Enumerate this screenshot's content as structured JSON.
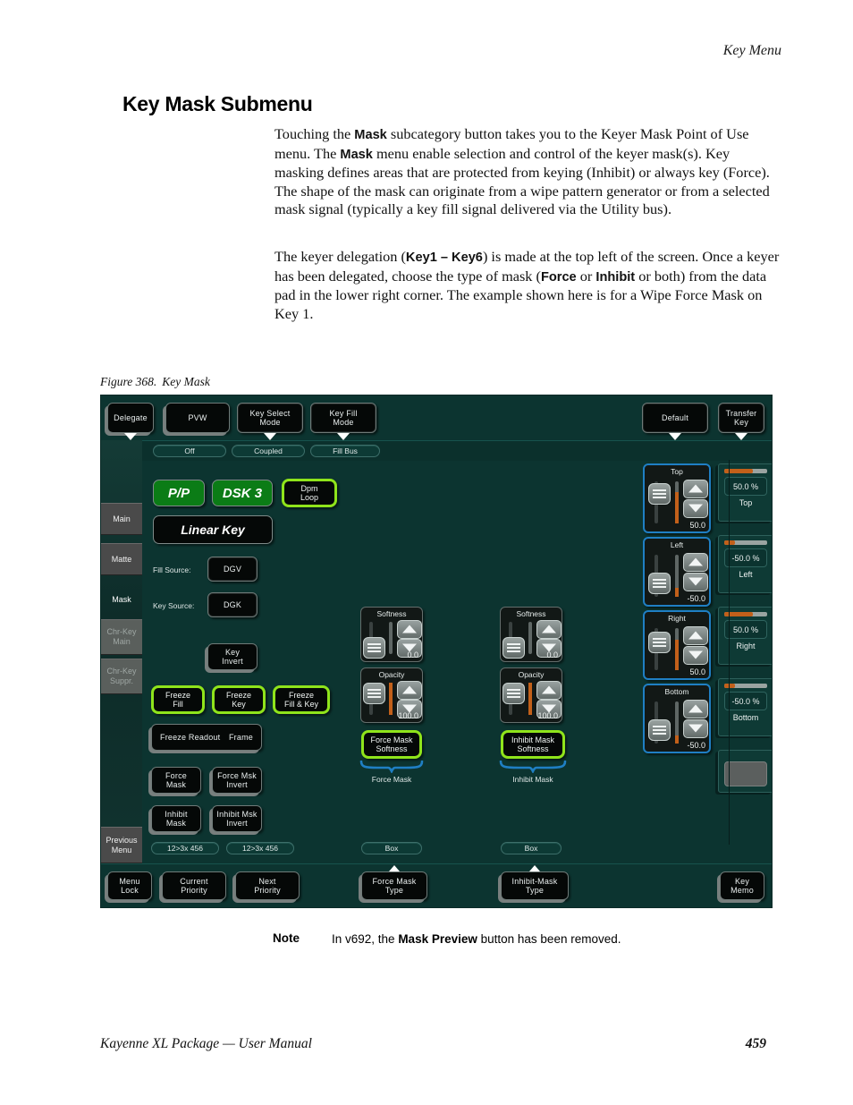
{
  "page": {
    "running_head": "Key Menu",
    "title": "Key Mask Submenu",
    "footer_left": "Kayenne XL Package  —  User Manual",
    "footer_page": "459"
  },
  "paragraphs": {
    "p1_a": "Touching the ",
    "p1_b1": "Mask",
    "p1_c": " subcategory button takes you to the Keyer Mask Point of Use menu. The ",
    "p1_b2": "Mask",
    "p1_d": " menu enable selection and control of the keyer mask(s). Key masking defines areas that are protected from keying (Inhibit) or always key (Force). The shape of the mask can originate from a wipe pattern generator or from a selected mask signal (typically a key fill signal delivered via the Utility bus).",
    "p2_a": "The keyer delegation (",
    "p2_b1": "Key1 – Key6",
    "p2_c": ") is made at the top left of the screen. Once a keyer has been delegated, choose the type of mask (",
    "p2_b2": "Force",
    "p2_d": " or ",
    "p2_b3": "Inhibit",
    "p2_e": "  or both) from the data pad in the lower right corner. The example shown here is for a Wipe Force Mask on Key 1."
  },
  "figure": {
    "number": "Figure 368.",
    "caption": "Key Mask"
  },
  "note": {
    "label": "Note",
    "text_a": "In v692, the ",
    "text_b": "Mask Preview",
    "text_c": " button has been removed."
  },
  "ui": {
    "topbar": {
      "delegate": "Delegate",
      "pvw": "PVW",
      "key_select_mode": "Key Select\nMode",
      "key_fill_mode": "Key Fill\nMode",
      "default": "Default",
      "transfer_key": "Transfer\nKey"
    },
    "substrip": {
      "off": "Off",
      "coupled": "Coupled",
      "fill_bus": "Fill Bus"
    },
    "leftnav": {
      "main": "Main",
      "matte": "Matte",
      "mask": "Mask",
      "chr_key_main": "Chr-Key\nMain",
      "chr_key_suppr": "Chr-Key\nSuppr.",
      "previous_menu": "Previous\nMenu"
    },
    "keyer": {
      "pp": "P/P",
      "dsk3": "DSK 3",
      "dpm_loop": "Dpm\nLoop",
      "linear_key": "Linear Key",
      "fill_source_label": "Fill Source:",
      "fill_source_value": "DGV",
      "key_source_label": "Key Source:",
      "key_source_value": "DGK",
      "key_invert": "Key\nInvert",
      "freeze_fill": "Freeze\nFill",
      "freeze_key": "Freeze\nKey",
      "freeze_fill_key": "Freeze\nFill & Key",
      "freeze_readout_label": "Freeze Readout",
      "freeze_readout_value": "Frame",
      "force_mask": "Force\nMask",
      "force_msk_invert": "Force Msk\nInvert",
      "inhibit_mask": "Inhibit\nMask",
      "inhibit_msk_invert": "Inhibit Msk\nInvert",
      "pager_left": "12>3x 456",
      "pager_right": "12>3x 456"
    },
    "force_column": {
      "softness_title": "Softness",
      "softness_value": "0.0",
      "opacity_title": "Opacity",
      "opacity_value": "100.0",
      "mask_softness_btn": "Force Mask\nSoftness",
      "group_label": "Force Mask",
      "box_pill": "Box"
    },
    "inhibit_column": {
      "softness_title": "Softness",
      "softness_value": "0.0",
      "opacity_title": "Opacity",
      "opacity_value": "100.0",
      "mask_softness_btn": "Inhibit Mask\nSoftness",
      "group_label": "Inhibit Mask",
      "box_pill": "Box"
    },
    "edge_sliders": [
      {
        "title": "Top",
        "value": "50.0"
      },
      {
        "title": "Left",
        "value": "-50.0"
      },
      {
        "title": "Right",
        "value": "50.0"
      },
      {
        "title": "Bottom",
        "value": "-50.0"
      }
    ],
    "data_pads": [
      {
        "value": "50.0 %",
        "name": "Top",
        "fill_pct": 66
      },
      {
        "value": "-50.0 %",
        "name": "Left",
        "fill_pct": 26
      },
      {
        "value": "50.0 %",
        "name": "Right",
        "fill_pct": 66
      },
      {
        "value": "-50.0 %",
        "name": "Bottom",
        "fill_pct": 26
      }
    ],
    "bottombar": {
      "menu_lock": "Menu\nLock",
      "current_priority": "Current\nPriority",
      "next_priority": "Next\nPriority",
      "force_mask_type": "Force Mask\nType",
      "inhibit_mask_type": "Inhibit-Mask\nType",
      "key_memo": "Key\nMemo"
    },
    "colors": {
      "panel_bg": "#0c3430",
      "select_green": "#8fe41b",
      "source_green": "#0b7c16",
      "slider_blue": "#1f7fc4",
      "bar_orange": "#c2601a",
      "brace_blue": "#1f7fc4"
    }
  }
}
